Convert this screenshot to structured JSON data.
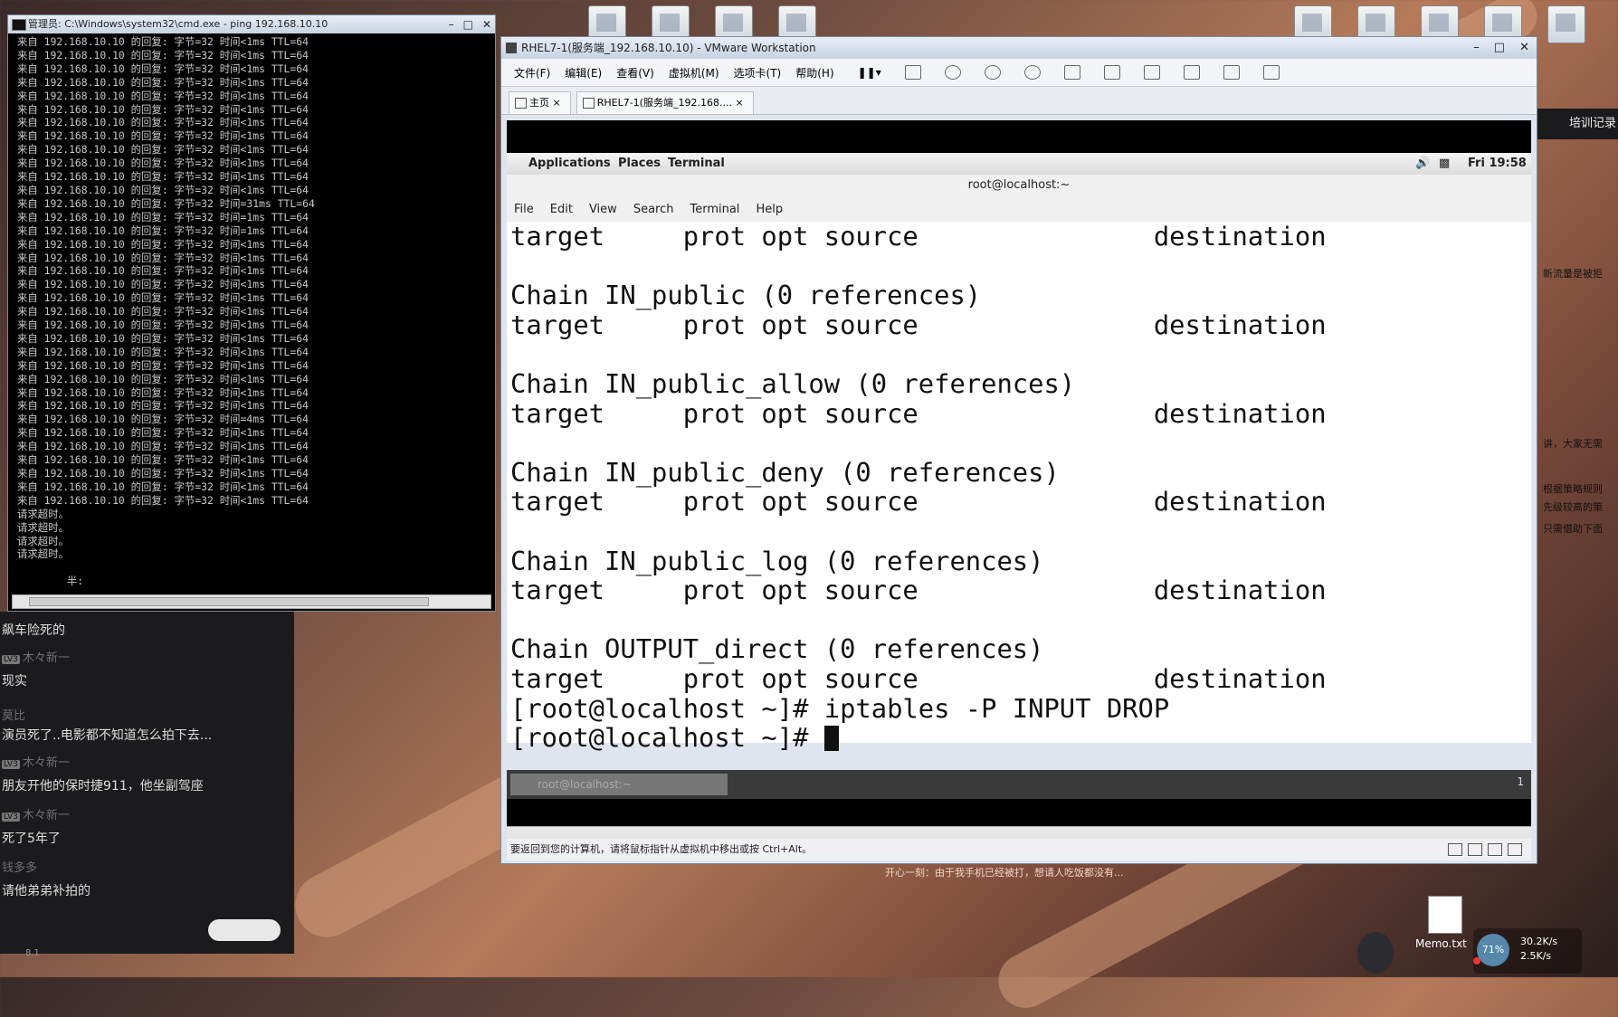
{
  "cmd": {
    "title": "管理员: C:\\Windows\\system32\\cmd.exe - ping  192.168.10.10",
    "lines": [
      "来自 192.168.10.10 的回复: 字节=32 时间<1ms TTL=64",
      "来自 192.168.10.10 的回复: 字节=32 时间<1ms TTL=64",
      "来自 192.168.10.10 的回复: 字节=32 时间<1ms TTL=64",
      "来自 192.168.10.10 的回复: 字节=32 时间<1ms TTL=64",
      "来自 192.168.10.10 的回复: 字节=32 时间<1ms TTL=64",
      "来自 192.168.10.10 的回复: 字节=32 时间<1ms TTL=64",
      "来自 192.168.10.10 的回复: 字节=32 时间<1ms TTL=64",
      "来自 192.168.10.10 的回复: 字节=32 时间<1ms TTL=64",
      "来自 192.168.10.10 的回复: 字节=32 时间<1ms TTL=64",
      "来自 192.168.10.10 的回复: 字节=32 时间<1ms TTL=64",
      "来自 192.168.10.10 的回复: 字节=32 时间<1ms TTL=64",
      "来自 192.168.10.10 的回复: 字节=32 时间<1ms TTL=64",
      "来自 192.168.10.10 的回复: 字节=32 时间=31ms TTL=64",
      "来自 192.168.10.10 的回复: 字节=32 时间=1ms TTL=64",
      "来自 192.168.10.10 的回复: 字节=32 时间=1ms TTL=64",
      "来自 192.168.10.10 的回复: 字节=32 时间<1ms TTL=64",
      "来自 192.168.10.10 的回复: 字节=32 时间<1ms TTL=64",
      "来自 192.168.10.10 的回复: 字节=32 时间<1ms TTL=64",
      "来自 192.168.10.10 的回复: 字节=32 时间<1ms TTL=64",
      "来自 192.168.10.10 的回复: 字节=32 时间<1ms TTL=64",
      "来自 192.168.10.10 的回复: 字节=32 时间<1ms TTL=64",
      "来自 192.168.10.10 的回复: 字节=32 时间<1ms TTL=64",
      "来自 192.168.10.10 的回复: 字节=32 时间<1ms TTL=64",
      "来自 192.168.10.10 的回复: 字节=32 时间<1ms TTL=64",
      "来自 192.168.10.10 的回复: 字节=32 时间<1ms TTL=64",
      "来自 192.168.10.10 的回复: 字节=32 时间<1ms TTL=64",
      "来自 192.168.10.10 的回复: 字节=32 时间<1ms TTL=64",
      "来自 192.168.10.10 的回复: 字节=32 时间<1ms TTL=64",
      "来自 192.168.10.10 的回复: 字节=32 时间=4ms TTL=64",
      "来自 192.168.10.10 的回复: 字节=32 时间<1ms TTL=64",
      "来自 192.168.10.10 的回复: 字节=32 时间<1ms TTL=64",
      "来自 192.168.10.10 的回复: 字节=32 时间<1ms TTL=64",
      "来自 192.168.10.10 的回复: 字节=32 时间<1ms TTL=64",
      "来自 192.168.10.10 的回复: 字节=32 时间<1ms TTL=64",
      "来自 192.168.10.10 的回复: 字节=32 时间<1ms TTL=64",
      "请求超时。",
      "请求超时。",
      "请求超时。",
      "请求超时。",
      "",
      "        半:"
    ]
  },
  "chat": {
    "messages": [
      {
        "user": "",
        "text": "飙车险死的"
      },
      {
        "user": "木々新一",
        "lv": "LV3",
        "text": "现实"
      },
      {
        "user": "莫比",
        "text": "演员死了..电影都不知道怎么拍下去..."
      },
      {
        "user": "木々新一",
        "lv": "LV3",
        "text": "朋友开他的保时捷911，他坐副驾座"
      },
      {
        "user": "木々新一",
        "lv": "LV3",
        "text": "死了5年了"
      },
      {
        "user": "钱多多",
        "text": "请他弟弟补拍的"
      }
    ],
    "footer_num": "8.1"
  },
  "vmware": {
    "title": "RHEL7-1(服务端_192.168.10.10) - VMware Workstation",
    "menu": [
      "文件(F)",
      "编辑(E)",
      "查看(V)",
      "虚拟机(M)",
      "选项卡(T)",
      "帮助(H)"
    ],
    "tabs": [
      {
        "label": "主页"
      },
      {
        "label": "RHEL7-1(服务端_192.168...."
      }
    ],
    "gnome": {
      "applications": "Applications",
      "places": "Places",
      "terminal": "Terminal",
      "clock": "Fri 19:58"
    },
    "terminal": {
      "title": "root@localhost:~",
      "menu": [
        "File",
        "Edit",
        "View",
        "Search",
        "Terminal",
        "Help"
      ],
      "lines": [
        "target     prot opt source               destination",
        "",
        "Chain IN_public (0 references)",
        "target     prot opt source               destination",
        "",
        "Chain IN_public_allow (0 references)",
        "target     prot opt source               destination",
        "",
        "Chain IN_public_deny (0 references)",
        "target     prot opt source               destination",
        "",
        "Chain IN_public_log (0 references)",
        "target     prot opt source               destination",
        "",
        "Chain OUTPUT_direct (0 references)",
        "target     prot opt source               destination",
        "[root@localhost ~]# iptables -P INPUT DROP"
      ],
      "prompt": "[root@localhost ~]# "
    },
    "taskbar": {
      "task": "root@localhost:~",
      "page": "1"
    },
    "status": "要返回到您的计算机，请将鼠标指针从虚拟机中移出或按 Ctrl+Alt。"
  },
  "right_panel": {
    "tag": "培训记录",
    "snippets": [
      "新流量是被拒",
      "讲，大家无需",
      "根据策略规则",
      "先级较高的策",
      "只需借助下面"
    ]
  },
  "tray": {
    "memo": "Memo.txt",
    "cpu": "71%",
    "up": "30.2K/s",
    "down": "2.5K/s",
    "bottom_note": "开心一刻：由于我手机已经被打，想请人吃饭都没有..."
  }
}
